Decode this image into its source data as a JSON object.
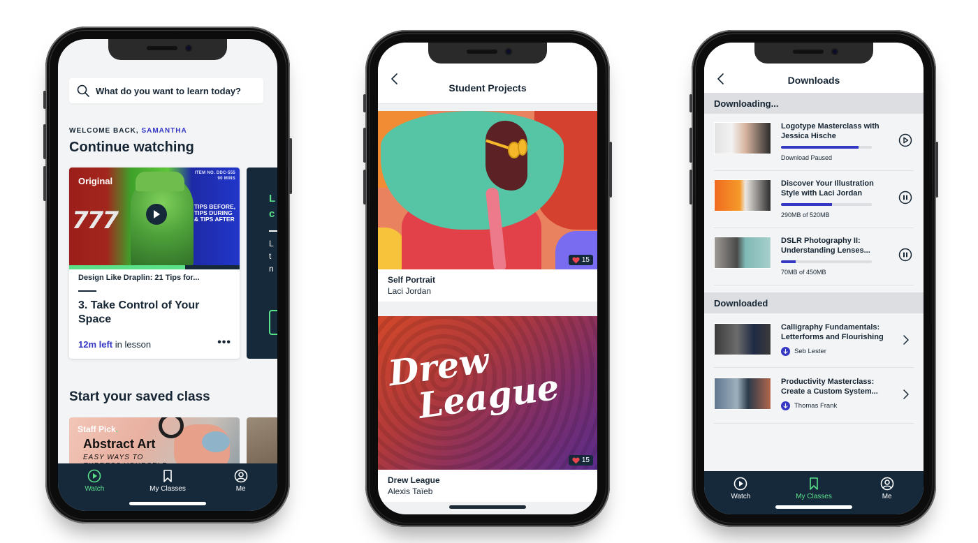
{
  "phone1": {
    "search": {
      "placeholder": "What do you want to learn today?"
    },
    "welcome": {
      "prefix": "WELCOME BACK, ",
      "name": "SAMANTHA"
    },
    "continue_heading": "Continue watching",
    "continue_card": {
      "badge": "Original",
      "item_no": "ITEM NO. DDC-555",
      "duration": "90 MINS",
      "thumb_sevens": "777",
      "thumb_text": [
        "TIPS BEFORE,",
        "TIPS DURING",
        "& TIPS AFTER"
      ],
      "progress": 0.68,
      "course_title": "Design Like Draplin: 21 Tips for...",
      "lesson_title": "3. Take Control of Your Space",
      "time_left": "12m left",
      "time_suffix": " in lesson",
      "more_label": "•••"
    },
    "peek_card": {
      "letters": [
        "L",
        "c"
      ],
      "lines": [
        "L",
        "t",
        "n"
      ]
    },
    "saved_heading": "Start your saved class",
    "saved_card": {
      "badge": "Staff Pick",
      "badge_dot": ".",
      "title": "Abstract Art",
      "subtitle_lines": [
        "EASY WAYS TO",
        "EXPRESS YOURSELF"
      ]
    },
    "tabbar": [
      {
        "label": "Watch",
        "icon": "play-circle-icon",
        "active": true
      },
      {
        "label": "My Classes",
        "icon": "bookmark-icon",
        "active": false
      },
      {
        "label": "Me",
        "icon": "user-circle-icon",
        "active": false
      }
    ]
  },
  "phone2": {
    "title": "Student Projects",
    "projects": [
      {
        "title": "Self Portrait",
        "author": "Laci Jordan",
        "likes": "15"
      },
      {
        "title": "Drew League",
        "author": "Alexis Taïeb",
        "likes": "15",
        "art_lines": [
          "Drew",
          "League"
        ]
      }
    ]
  },
  "phone3": {
    "title": "Downloads",
    "downloading_heading": "Downloading...",
    "downloading": [
      {
        "title": "Logotype Masterclass with Jessica Hische",
        "status": "Download Paused",
        "progress": 0.85,
        "action": "play"
      },
      {
        "title": "Discover Your Illustration Style with Laci Jordan",
        "status": "290MB of 520MB",
        "progress": 0.56,
        "action": "pause"
      },
      {
        "title": "DSLR Photography II: Understanding Lenses...",
        "status": "70MB of 450MB",
        "progress": 0.16,
        "action": "pause"
      }
    ],
    "downloaded_heading": "Downloaded",
    "downloaded": [
      {
        "title": "Calligraphy Fundamentals: Letterforms and Flourishing",
        "author": "Seb Lester"
      },
      {
        "title": "Productivity Masterclass: Create a Custom System...",
        "author": "Thomas Frank"
      }
    ],
    "tabbar": [
      {
        "label": "Watch",
        "icon": "play-circle-icon",
        "active": false
      },
      {
        "label": "My Classes",
        "icon": "bookmark-icon",
        "active": true
      },
      {
        "label": "Me",
        "icon": "user-circle-icon",
        "active": false
      }
    ]
  },
  "colors": {
    "navy": "#15293b",
    "accent_green": "#5be08a",
    "accent_blue": "#3436c4",
    "text": "#162533",
    "screen_bg": "#f3f4f5",
    "section_bg": "#dcdee1"
  }
}
